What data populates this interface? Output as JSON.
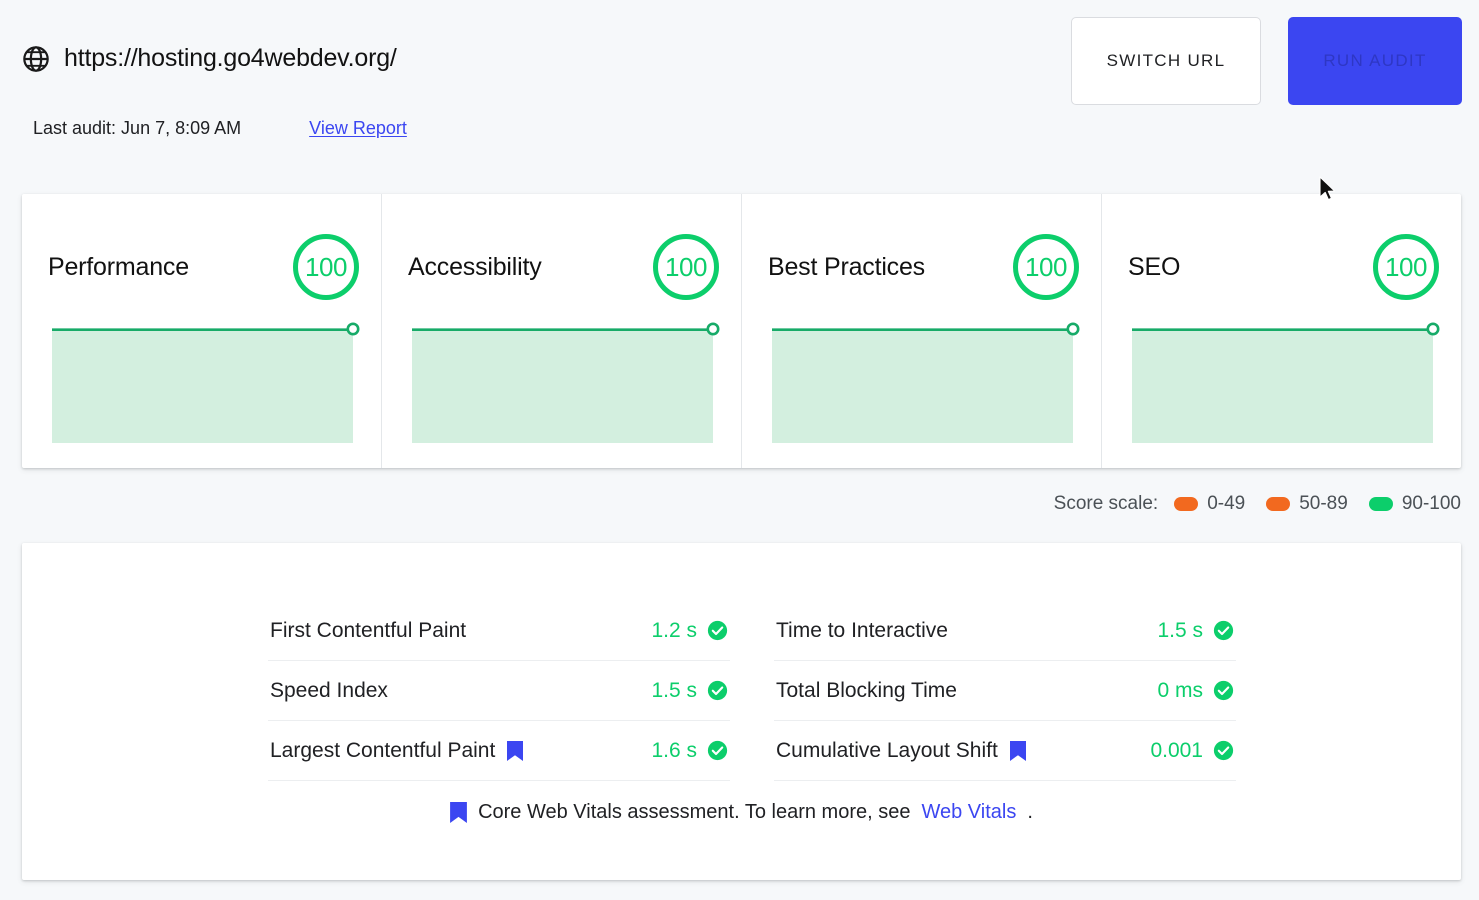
{
  "header": {
    "globe_icon": "globe-icon",
    "url": "https://hosting.go4webdev.org/",
    "last_audit": "Last audit: Jun 7, 8:09 AM",
    "view_report": "View Report",
    "switch_url_label": "SWITCH URL",
    "run_audit_label": "RUN AUDIT",
    "accent_blue": "#3b46f1",
    "link_blue": "#3b46f1"
  },
  "scores": {
    "pass_color": "#0cce6b",
    "fill_color": "#d3efdf",
    "cards": [
      {
        "title": "Performance",
        "score": "100"
      },
      {
        "title": "Accessibility",
        "score": "100"
      },
      {
        "title": "Best Practices",
        "score": "100"
      },
      {
        "title": "SEO",
        "score": "100"
      }
    ]
  },
  "legend": {
    "label": "Score scale:",
    "items": [
      {
        "range": "0-49",
        "color": "#f2691f"
      },
      {
        "range": "50-89",
        "color": "#f2691f"
      },
      {
        "range": "90-100",
        "color": "#0cce6b"
      }
    ]
  },
  "metrics": {
    "left": [
      {
        "name": "First Contentful Paint",
        "value": "1.2 s",
        "flag": false,
        "status": "pass"
      },
      {
        "name": "Speed Index",
        "value": "1.5 s",
        "flag": false,
        "status": "pass"
      },
      {
        "name": "Largest Contentful Paint",
        "value": "1.6 s",
        "flag": true,
        "status": "pass"
      }
    ],
    "right": [
      {
        "name": "Time to Interactive",
        "value": "1.5 s",
        "flag": false,
        "status": "pass"
      },
      {
        "name": "Total Blocking Time",
        "value": "0 ms",
        "flag": false,
        "status": "pass"
      },
      {
        "name": "Cumulative Layout Shift",
        "value": "0.001",
        "flag": true,
        "status": "pass"
      }
    ],
    "note_text": "Core Web Vitals assessment. To learn more, see ",
    "note_link": "Web Vitals",
    "note_suffix": "."
  },
  "chart_data": [
    {
      "type": "area",
      "title": "Performance",
      "x": [
        0,
        1,
        2,
        3,
        4,
        5,
        6,
        7,
        8,
        9
      ],
      "values": [
        100,
        100,
        100,
        100,
        100,
        100,
        100,
        100,
        100,
        100
      ],
      "ylim": [
        0,
        100
      ],
      "ylabel": "",
      "xlabel": "",
      "grid": false,
      "legend": "none",
      "line_color": "#0cce6b",
      "fill_color": "#d3efdf",
      "end_marker": true
    },
    {
      "type": "area",
      "title": "Accessibility",
      "x": [
        0,
        1,
        2,
        3,
        4,
        5,
        6,
        7,
        8,
        9
      ],
      "values": [
        100,
        100,
        100,
        100,
        100,
        100,
        100,
        100,
        100,
        100
      ],
      "ylim": [
        0,
        100
      ],
      "ylabel": "",
      "xlabel": "",
      "grid": false,
      "legend": "none",
      "line_color": "#0cce6b",
      "fill_color": "#d3efdf",
      "end_marker": true
    },
    {
      "type": "area",
      "title": "Best Practices",
      "x": [
        0,
        1,
        2,
        3,
        4,
        5,
        6,
        7,
        8,
        9
      ],
      "values": [
        100,
        100,
        100,
        100,
        100,
        100,
        100,
        100,
        100,
        100
      ],
      "ylim": [
        0,
        100
      ],
      "ylabel": "",
      "xlabel": "",
      "grid": false,
      "legend": "none",
      "line_color": "#0cce6b",
      "fill_color": "#d3efdf",
      "end_marker": true
    },
    {
      "type": "area",
      "title": "SEO",
      "x": [
        0,
        1,
        2,
        3,
        4,
        5,
        6,
        7,
        8,
        9
      ],
      "values": [
        100,
        100,
        100,
        100,
        100,
        100,
        100,
        100,
        100,
        100
      ],
      "ylim": [
        0,
        100
      ],
      "ylabel": "",
      "xlabel": "",
      "grid": false,
      "legend": "none",
      "line_color": "#0cce6b",
      "fill_color": "#d3efdf",
      "end_marker": true
    }
  ]
}
